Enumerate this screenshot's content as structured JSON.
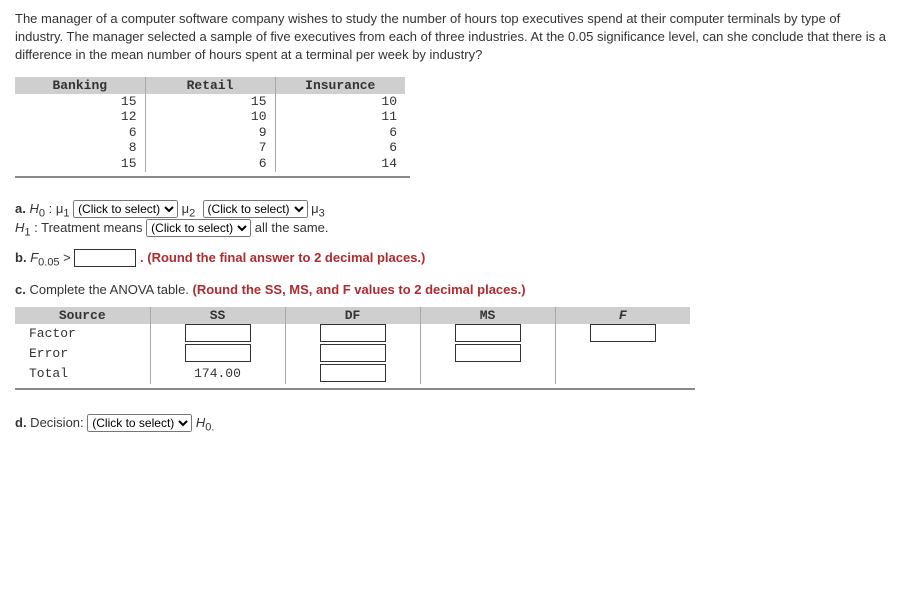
{
  "intro": "The manager of a computer software company wishes to study the number of hours top executives spend at their computer terminals by type of industry. The manager selected a sample of five executives from each of three industries. At the 0.05 significance level, can she conclude that there is a difference in the mean number of hours spent at a terminal per week by industry?",
  "dataTable": {
    "headers": [
      "Banking",
      "Retail",
      "Insurance"
    ],
    "rows": [
      [
        "15",
        "15",
        "10"
      ],
      [
        "12",
        "10",
        "11"
      ],
      [
        "6",
        "9",
        "6"
      ],
      [
        "8",
        "7",
        "6"
      ],
      [
        "15",
        "6",
        "14"
      ]
    ]
  },
  "partA": {
    "label": "a.",
    "H0_prefix": "H",
    "H0_sub": "0",
    "mu1_sub": "1",
    "mu2_sub": "2",
    "mu3_sub": "3",
    "select_placeholder": "(Click to select)",
    "H1_prefix": "H",
    "H1_sub": "1",
    "H1_text": ": Treatment means",
    "H1_suffix": " all the same."
  },
  "partB": {
    "label": "b.",
    "F_text": "F",
    "F_sub": "0.05",
    "gt": " >",
    "note": ". (Round the final answer to 2 decimal places.)"
  },
  "partC": {
    "label": "c.",
    "text": " Complete the ANOVA table. ",
    "note": "(Round the SS, MS, and F values to 2 decimal places.)",
    "headers": [
      "Source",
      "SS",
      "DF",
      "MS",
      "F"
    ],
    "rows": [
      {
        "source": "Factor",
        "ss_input": true,
        "df_input": true,
        "ms_input": true,
        "f_input": true
      },
      {
        "source": "Error",
        "ss_input": true,
        "df_input": true,
        "ms_input": true,
        "f_input": false
      },
      {
        "source": "Total",
        "ss_value": "174.00",
        "df_input": true,
        "ms_input": false,
        "f_input": false
      }
    ]
  },
  "partD": {
    "label": "d.",
    "text": " Decision: ",
    "select_placeholder": "(Click to select)",
    "H0": "H",
    "H0_sub": "0."
  }
}
